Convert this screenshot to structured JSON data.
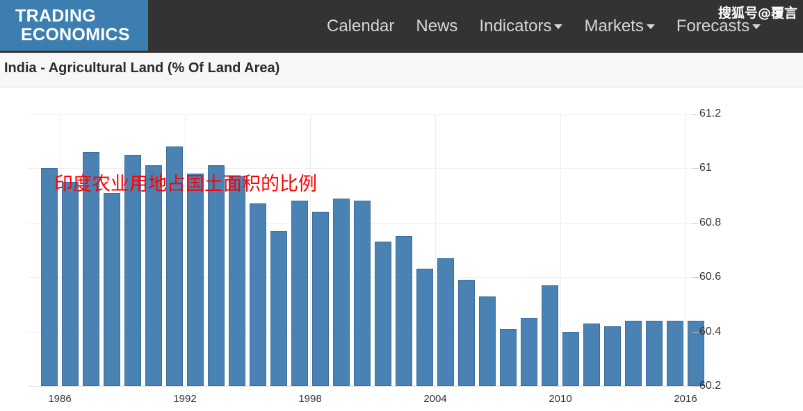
{
  "header": {
    "brand_line1": "TRADING",
    "brand_line2": "ECONOMICS",
    "brand_bg": "#3d7eb0",
    "bar_bg": "#333333",
    "watermark": "搜狐号@覆言",
    "nav": [
      {
        "label": "Calendar",
        "has_caret": false
      },
      {
        "label": "News",
        "has_caret": false
      },
      {
        "label": "Indicators",
        "has_caret": true
      },
      {
        "label": "Markets",
        "has_caret": true
      },
      {
        "label": "Forecasts",
        "has_caret": true
      }
    ]
  },
  "title_band": {
    "title": "India - Agricultural Land (% Of Land Area)"
  },
  "annotation": {
    "text": "印度农业用地占国土面积的比例",
    "color": "#ff0000"
  },
  "chart_data": {
    "type": "bar",
    "title": "India - Agricultural Land (% Of Land Area)",
    "xlabel": "",
    "ylabel": "",
    "ylim": [
      60.2,
      61.2
    ],
    "ytick_values": [
      61.2,
      61,
      60.8,
      60.6,
      60.4,
      60.2
    ],
    "ytick_labels": [
      "61.2",
      "61",
      "60.8",
      "60.6",
      "60.4",
      "60.2"
    ],
    "xtick_labels": [
      "1986",
      "1992",
      "1998",
      "2004",
      "2010",
      "2016"
    ],
    "grid": true,
    "legend": false,
    "bar_color": "#4a82b4",
    "categories": [
      "1985",
      "1986",
      "1987",
      "1988",
      "1989",
      "1990",
      "1991",
      "1992",
      "1993",
      "1994",
      "1995",
      "1996",
      "1997",
      "1998",
      "1999",
      "2000",
      "2001",
      "2002",
      "2003",
      "2004",
      "2005",
      "2006",
      "2007",
      "2008",
      "2009",
      "2010",
      "2011",
      "2012",
      "2013",
      "2014",
      "2015",
      "2016"
    ],
    "values": [
      61.0,
      60.95,
      61.06,
      60.91,
      61.05,
      61.01,
      61.08,
      60.98,
      61.01,
      60.97,
      60.87,
      60.77,
      60.88,
      60.84,
      60.89,
      60.88,
      60.73,
      60.75,
      60.63,
      60.67,
      60.59,
      60.53,
      60.41,
      60.45,
      60.57,
      60.4,
      60.43,
      60.42,
      60.44,
      60.44,
      60.44,
      60.44
    ]
  }
}
